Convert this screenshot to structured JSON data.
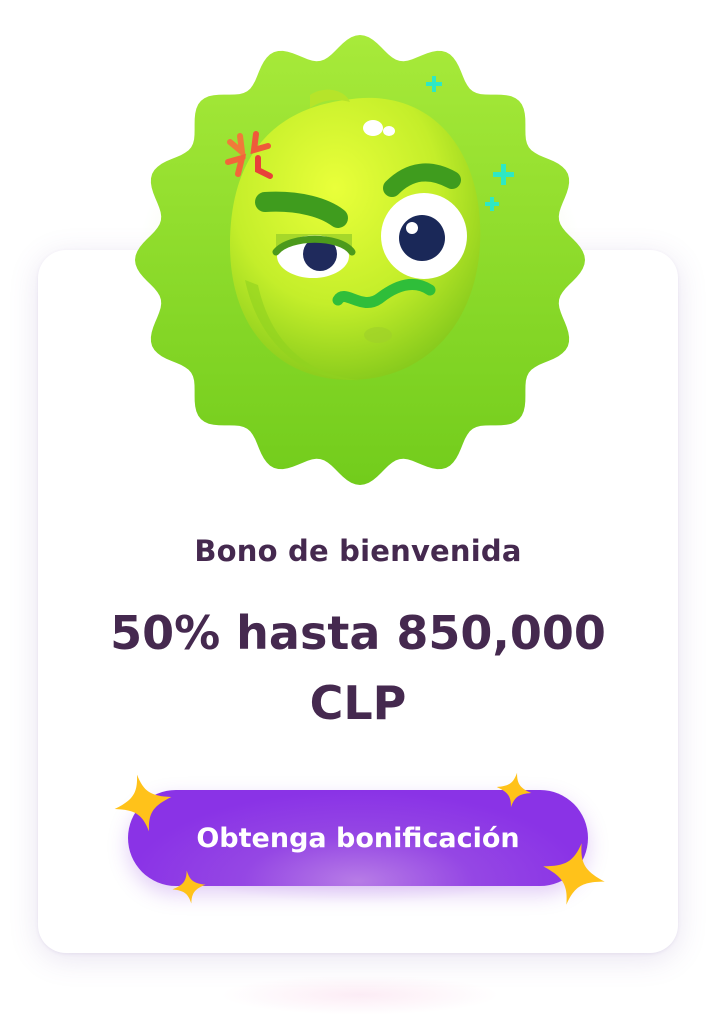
{
  "bonus": {
    "subtitle": "Bono de bienvenida",
    "headline": "50% hasta 850,000 CLP"
  },
  "cta": {
    "label": "Obtenga bonificación"
  },
  "mascot": {
    "icon": "lime-mascot-icon",
    "badge_color": "#8fdc2c"
  },
  "colors": {
    "text": "#45294f",
    "button": "#8a33e6",
    "star": "#ffc21a"
  }
}
